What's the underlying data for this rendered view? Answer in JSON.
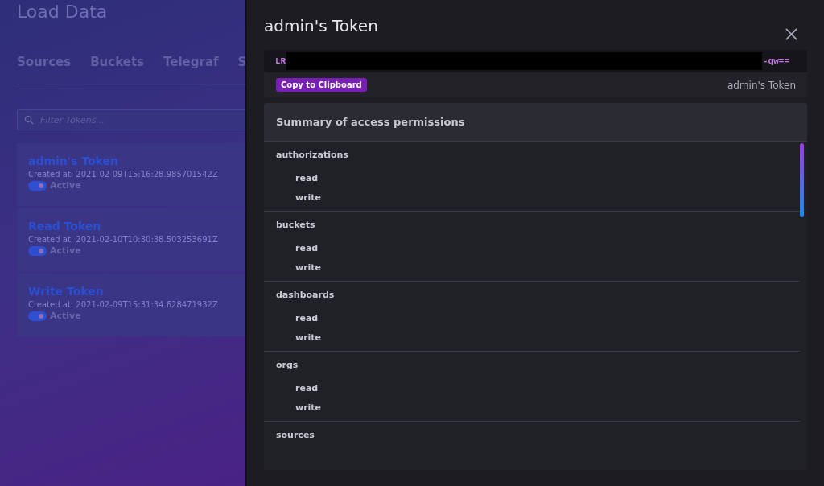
{
  "page": {
    "title": "Load Data",
    "tabs": [
      {
        "label": "Sources",
        "selected": false
      },
      {
        "label": "Buckets",
        "selected": false
      },
      {
        "label": "Telegraf",
        "selected": false
      },
      {
        "label": "S",
        "selected": false
      }
    ],
    "filter": {
      "placeholder": "Filter Tokens..."
    },
    "tokens": [
      {
        "name": "admin's Token",
        "created": "Created at: 2021-02-09T15:16:28.985701542Z",
        "active": true,
        "status": "Active"
      },
      {
        "name": "Read Token",
        "created": "Created at: 2021-02-10T10:30:38.503253691Z",
        "active": true,
        "status": "Active"
      },
      {
        "name": "Write Token",
        "created": "Created at: 2021-02-09T15:31:34.628471932Z",
        "active": true,
        "status": "Active"
      }
    ]
  },
  "dialog": {
    "title": "admin's Token",
    "token_start": "LR",
    "token_end": "-qw==",
    "copy_button": "Copy to Clipboard",
    "token_label": "admin's Token",
    "summary_title": "Summary of access permissions",
    "permissions": [
      {
        "resource": "authorizations",
        "actions": [
          "read",
          "write"
        ]
      },
      {
        "resource": "buckets",
        "actions": [
          "read",
          "write"
        ]
      },
      {
        "resource": "dashboards",
        "actions": [
          "read",
          "write"
        ]
      },
      {
        "resource": "orgs",
        "actions": [
          "read",
          "write"
        ]
      },
      {
        "resource": "sources"
      }
    ]
  }
}
